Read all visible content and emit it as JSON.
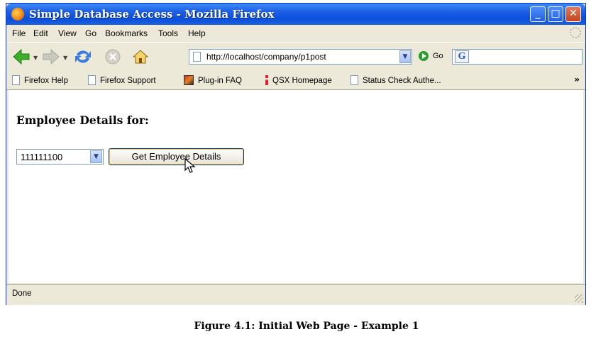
{
  "window": {
    "title": "Simple Database Access - Mozilla Firefox",
    "minimize": "_",
    "maximize": "□",
    "close": "✕"
  },
  "menu": {
    "items": [
      {
        "label": "File"
      },
      {
        "label": "Edit"
      },
      {
        "label": "View"
      },
      {
        "label": "Go"
      },
      {
        "label": "Bookmarks"
      },
      {
        "label": "Tools"
      },
      {
        "label": "Help"
      }
    ]
  },
  "nav": {
    "url": "http://localhost/company/p1post",
    "go_label": "Go",
    "search_engine": "G",
    "icons": [
      "back-arrow-icon",
      "forward-arrow-icon",
      "reload-icon",
      "stop-icon",
      "home-icon"
    ]
  },
  "bookmarks": {
    "items": [
      {
        "label": "Firefox Help"
      },
      {
        "label": "Firefox Support"
      },
      {
        "label": "Plug-in FAQ"
      },
      {
        "label": "QSX Homepage"
      },
      {
        "label": "Status Check Authe..."
      }
    ],
    "more": "»"
  },
  "page": {
    "heading": "Employee Details for:",
    "select_value": "111111100",
    "button_label": "Get Employee Details"
  },
  "status": {
    "text": "Done"
  },
  "caption": "Figure 4.1: Initial Web Page - Example 1",
  "colors": {
    "titlebar": "#0b4fdb",
    "chrome": "#ece9d8",
    "back_arrow": "#3fae2a"
  }
}
